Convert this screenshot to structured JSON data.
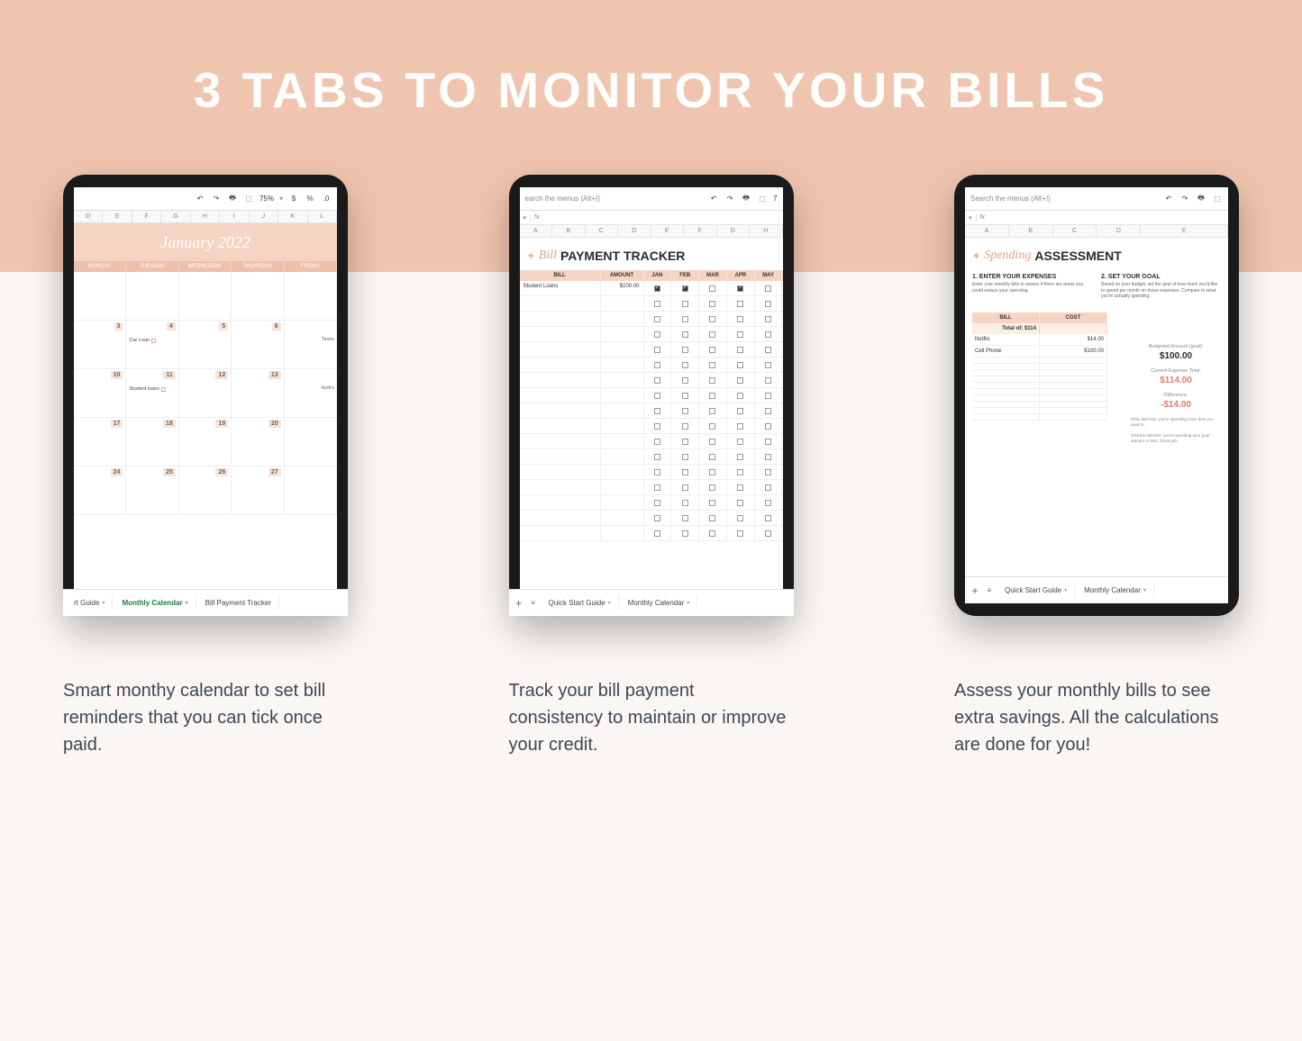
{
  "headline": "3 TABS TO MONITOR YOUR BILLS",
  "tablet1": {
    "zoom": "75%",
    "search_hint": "",
    "cal_title": "January 2022",
    "days": [
      "MONDAY",
      "TUESDAY",
      "WEDNESDAY",
      "THURSDAY",
      "FRIDAY"
    ],
    "weeks": [
      [
        {
          "d": ""
        },
        {
          "d": ""
        },
        {
          "d": ""
        },
        {
          "d": ""
        },
        {
          "d": ""
        }
      ],
      [
        {
          "d": "3"
        },
        {
          "d": "4",
          "note": "Car Loan",
          "box": true
        },
        {
          "d": "5"
        },
        {
          "d": "6"
        },
        {
          "d": "",
          "side": "Taxes"
        }
      ],
      [
        {
          "d": "10"
        },
        {
          "d": "11",
          "note": "Student loans",
          "box": true
        },
        {
          "d": "12"
        },
        {
          "d": "13"
        },
        {
          "d": "",
          "side": "Hydro"
        }
      ],
      [
        {
          "d": "17"
        },
        {
          "d": "18"
        },
        {
          "d": "19"
        },
        {
          "d": "20"
        },
        {
          "d": ""
        }
      ],
      [
        {
          "d": "24"
        },
        {
          "d": "25"
        },
        {
          "d": "26"
        },
        {
          "d": "27"
        },
        {
          "d": ""
        }
      ]
    ],
    "tabs": {
      "a": "rt Guide",
      "b": "Monthly Calendar",
      "c": "Bill Payment Tracker"
    }
  },
  "tablet2": {
    "search_hint": "earch the menus (Alt+/)",
    "zoom": "7",
    "title_cursive": "Bill",
    "title_rest": "PAYMENT TRACKER",
    "cols": {
      "bill": "BILL",
      "amount": "AMOUNT",
      "months": [
        "JAN",
        "FEB",
        "MAR",
        "APR",
        "MAY"
      ]
    },
    "rows": [
      {
        "bill": "Student Loans",
        "amount": "$100.00",
        "checks": [
          true,
          true,
          false,
          true,
          false
        ]
      }
    ],
    "blank_rows": 16,
    "tabs": {
      "a": "Quick Start Guide",
      "b": "Monthly Calendar"
    }
  },
  "tablet3": {
    "search_hint": "Search the menus (Alt+/)",
    "title_cursive": "Spending",
    "title_rest": "ASSESSMENT",
    "col1_head": "1. ENTER YOUR EXPENSES",
    "col1_sub": "Enter your monthly bills to assess if there are areas you could reduce your spending.",
    "col2_head": "2. SET YOUR GOAL",
    "col2_sub": "Based on your budget, set the goal of how much you'd like to spend per month on those expenses. Compare to what you're actually spending.",
    "table": {
      "h_bill": "BILL",
      "h_cost": "COST",
      "total_label": "Total of:",
      "total_val": "$114",
      "rows": [
        {
          "bill": "Netflix",
          "cost": "$14.00"
        },
        {
          "bill": "Cell Phone",
          "cost": "$100.00"
        }
      ],
      "blank_rows": 10
    },
    "goal": {
      "budget_lbl": "Budgeted Amount (goal):",
      "budget_val": "$100.00",
      "expense_lbl": "Current Expense Total:",
      "expense_val": "$114.00",
      "diff_lbl": "Difference:",
      "diff_val": "-$14.00",
      "note1": "PINK MEANS: you're spending more than you want to.",
      "note2": "GREEN MEANS: you're spending your goal amount or less. Great job!"
    },
    "tabs": {
      "a": "Quick Start Guide",
      "b": "Monthly Calendar"
    }
  },
  "captions": [
    "Smart monthy calendar to set bill reminders that you can tick once paid.",
    "Track your bill payment consistency to maintain or improve your credit.",
    "Assess your monthly bills to see extra savings. All the calculations are done for you!"
  ]
}
